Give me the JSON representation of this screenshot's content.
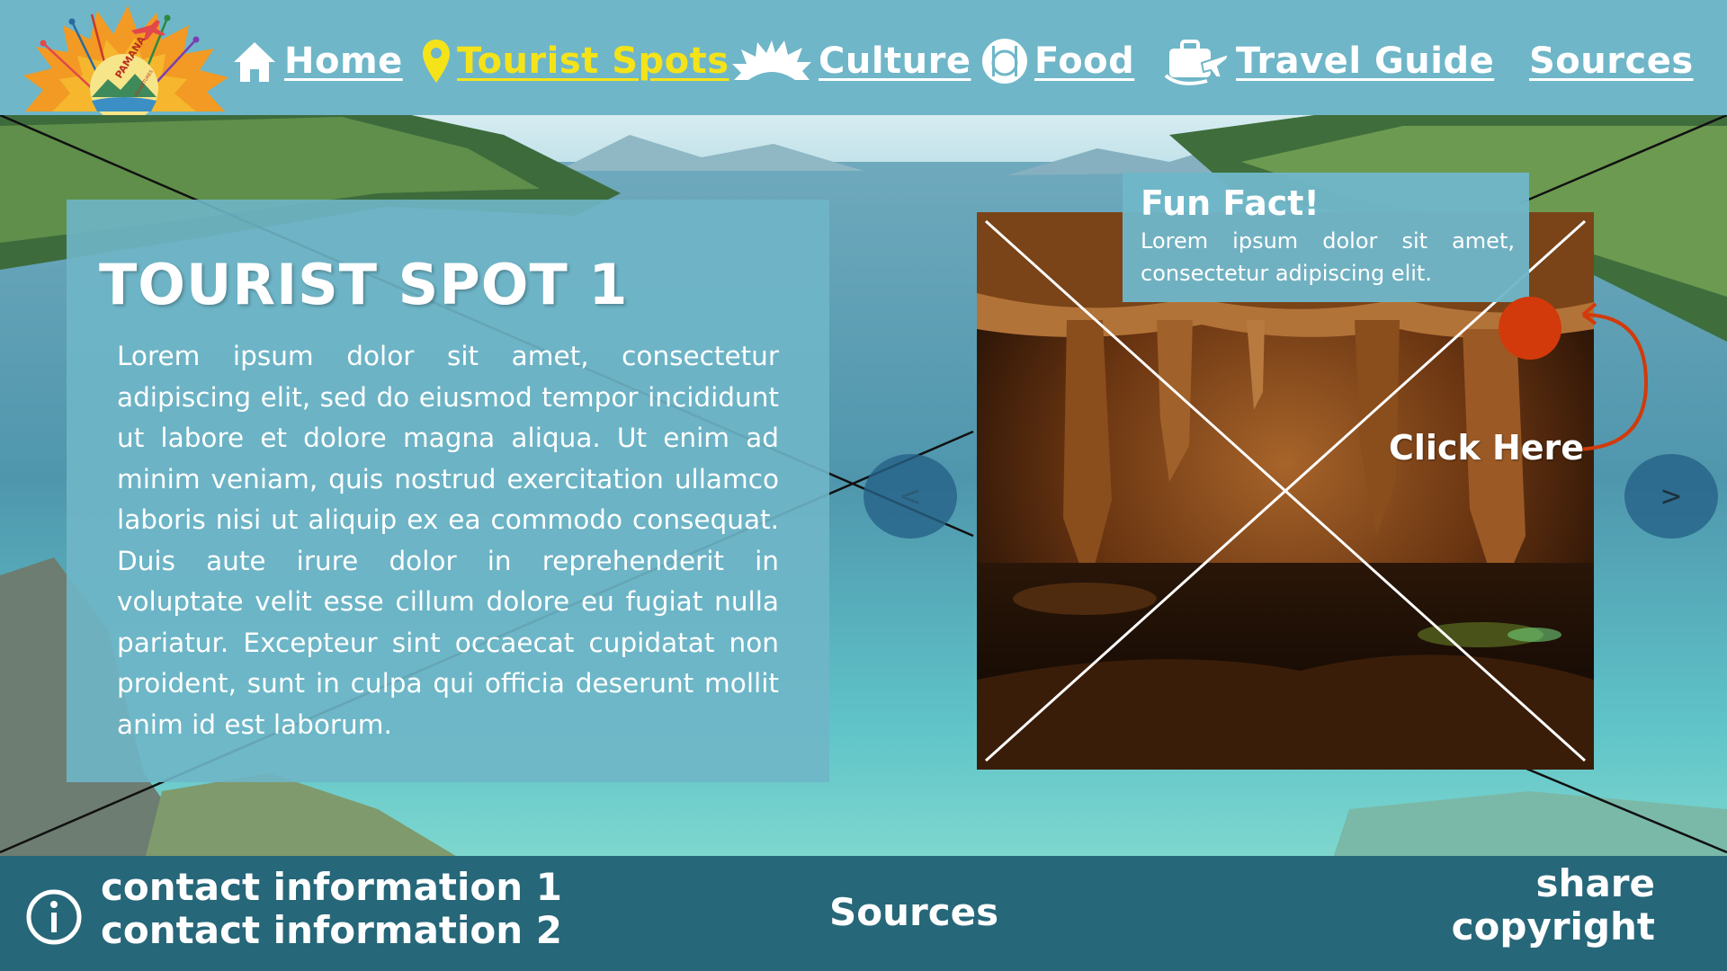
{
  "brand": {
    "logo_text": "PAMANA",
    "logo_subtext": "ADVENTURES"
  },
  "nav": [
    {
      "label": "Home",
      "icon": "home-icon"
    },
    {
      "label": "Tourist Spots",
      "icon": "map-pin-icon",
      "active": true
    },
    {
      "label": "Culture",
      "icon": "sun-rays-icon"
    },
    {
      "label": "Food",
      "icon": "plate-cutlery-icon"
    },
    {
      "label": "Travel Guide",
      "icon": "suitcase-plane-icon"
    },
    {
      "label": "Sources"
    }
  ],
  "main": {
    "title": "TOURIST SPOT 1",
    "body": "Lorem ipsum dolor sit amet, consectetur adipiscing elit, sed do eiusmod tempor incididunt ut labore et dolore magna aliqua. Ut enim ad minim veniam, quis nostrud exercitation ullamco laboris nisi ut aliquip ex ea commodo consequat. Duis aute irure dolor in reprehenderit in voluptate velit esse cillum dolore eu fugiat nulla pariatur. Excepteur sint occaecat cupidatat non proident, sunt in culpa qui officia deserunt mollit anim id est laborum."
  },
  "fun_fact": {
    "title": "Fun Fact!",
    "text": "Lorem ipsum dolor sit amet, consectetur adipiscing elit."
  },
  "hotspot": {
    "label": "Click Here"
  },
  "carousel": {
    "prev": "<",
    "next": ">"
  },
  "footer": {
    "contact_1": "contact information 1",
    "contact_2": "contact information 2",
    "sources": "Sources",
    "share": "share",
    "copyright": "copyright"
  },
  "colors": {
    "header_bg": "#6fb6c8",
    "footer_bg": "#266779",
    "active_nav": "#f5e31a",
    "accent": "#d23a0c"
  }
}
